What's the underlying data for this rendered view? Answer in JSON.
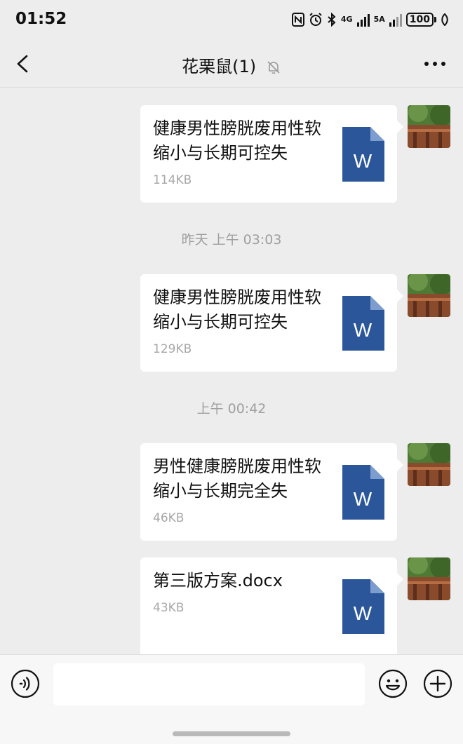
{
  "status_bar": {
    "time": "01:52",
    "network_4g": "4G",
    "network_5a": "5A",
    "battery": "100"
  },
  "header": {
    "title": "花栗鼠(1)"
  },
  "messages": [
    {
      "file_name": "健康男性膀胱废用性软缩小与长期可控失",
      "size": "114KB",
      "file_type": "W"
    },
    {
      "timestamp": "昨天 上午 03:03"
    },
    {
      "file_name": "健康男性膀胱废用性软缩小与长期可控失",
      "size": "129KB",
      "file_type": "W"
    },
    {
      "timestamp": "上午 00:42"
    },
    {
      "file_name": "男性健康膀胱废用性软缩小与长期完全失",
      "size": "46KB",
      "file_type": "W"
    },
    {
      "file_name": "第三版方案.docx",
      "size": "43KB",
      "file_type": "W"
    }
  ],
  "icons": {
    "back": "chevron-left-icon",
    "mute": "bell-off-icon",
    "more": "more-horizontal-icon",
    "voice": "voice-icon",
    "emoji": "emoji-icon",
    "plus": "plus-circle-icon",
    "file": "word-document-icon"
  },
  "colors": {
    "background": "#ededed",
    "bubble": "#ffffff",
    "word_blue": "#2b579a",
    "word_fold": "#7d9dce",
    "muted_text": "#a8a8a8"
  }
}
